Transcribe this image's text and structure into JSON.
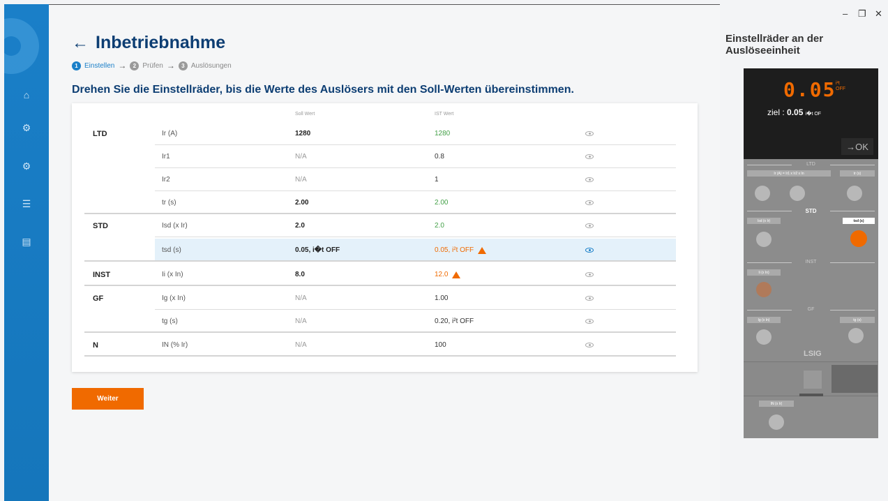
{
  "window": {
    "minimize": "–",
    "restore": "❐",
    "close": "✕"
  },
  "sidebar": {
    "items": [
      {
        "icon": "home-icon",
        "glyph": "⌂"
      },
      {
        "icon": "settings-adjust-icon",
        "glyph": "⚙"
      },
      {
        "icon": "gears-icon",
        "glyph": "⚙"
      },
      {
        "icon": "list-check-icon",
        "glyph": "☰"
      },
      {
        "icon": "report-icon",
        "glyph": "▤"
      }
    ]
  },
  "header": {
    "title": "Inbetriebnahme",
    "back": "←"
  },
  "steps": [
    {
      "num": "1",
      "label": "Einstellen",
      "active": true
    },
    {
      "num": "2",
      "label": "Prüfen",
      "active": false
    },
    {
      "num": "3",
      "label": "Auslösungen",
      "active": false
    }
  ],
  "step_arrow": "→",
  "instruction": "Drehen Sie die Einstellräder, bis die Werte des Auslösers mit den Soll-Werten übereinstimmen.",
  "table": {
    "headers": {
      "soll": "Soll Wert",
      "ist": "IST Wert"
    },
    "rows": [
      {
        "group": "LTD",
        "param": "Ir (A)",
        "soll": "1280",
        "ist": "1280"
      },
      {
        "group": "",
        "param": "Ir1",
        "soll": "N/A",
        "ist": "0.8"
      },
      {
        "group": "",
        "param": "Ir2",
        "soll": "N/A",
        "ist": "1"
      },
      {
        "group": "",
        "param": "tr (s)",
        "soll": "2.00",
        "ist": "2.00"
      },
      {
        "group": "STD",
        "param": "Isd (x Ir)",
        "soll": "2.0",
        "ist": "2.0"
      },
      {
        "group": "",
        "param": "tsd (s)",
        "soll": "0.05, i�t OFF",
        "ist": "0.05, i²t OFF"
      },
      {
        "group": "INST",
        "param": "Ii (x In)",
        "soll": "8.0",
        "ist": "12.0"
      },
      {
        "group": "GF",
        "param": "Ig (x In)",
        "soll": "N/A",
        "ist": "1.00"
      },
      {
        "group": "",
        "param": "tg (s)",
        "soll": "N/A",
        "ist": "0.20, i²t OFF"
      },
      {
        "group": "N",
        "param": "IN (% Ir)",
        "soll": "N/A",
        "ist": "100"
      }
    ]
  },
  "buttons": {
    "next": "Weiter"
  },
  "right_panel": {
    "title": "Einstellräder an der Auslöseeinheit",
    "display_value": "0.05",
    "display_unit_top": "i²t",
    "display_unit_bottom": "OFF",
    "target_label": "ziel :",
    "target_value": "0.05",
    "target_unit": "i�t OF",
    "ok_label": "→OK",
    "sections": {
      "ltd": "LTD",
      "std": "STD",
      "inst": "INST",
      "gf": "GF"
    },
    "labels": {
      "ir_formula": "Ir (A) = Ir1 x Ir2 x In",
      "tr": "tr (s)",
      "isd": "Isd (x Ir)",
      "tsd": "tsd (s)",
      "ii": "Ii (x In)",
      "ig": "Ig (x In)",
      "tg": "tg (s)",
      "in": "IN (x Ir)"
    },
    "model": "LSIG",
    "tsd_scale": "0.60 — 0.60\n0.40 — 0.40\n0.30 — 0.30\n0.20 — 0.20\n0.10 — 0.10\n0.05 — 0.05\nOFF — i²t — ON"
  },
  "colors": {
    "primary": "#1a7fc8",
    "title": "#0d3e73",
    "accent": "#f06a00",
    "ok_green": "#43a047"
  }
}
